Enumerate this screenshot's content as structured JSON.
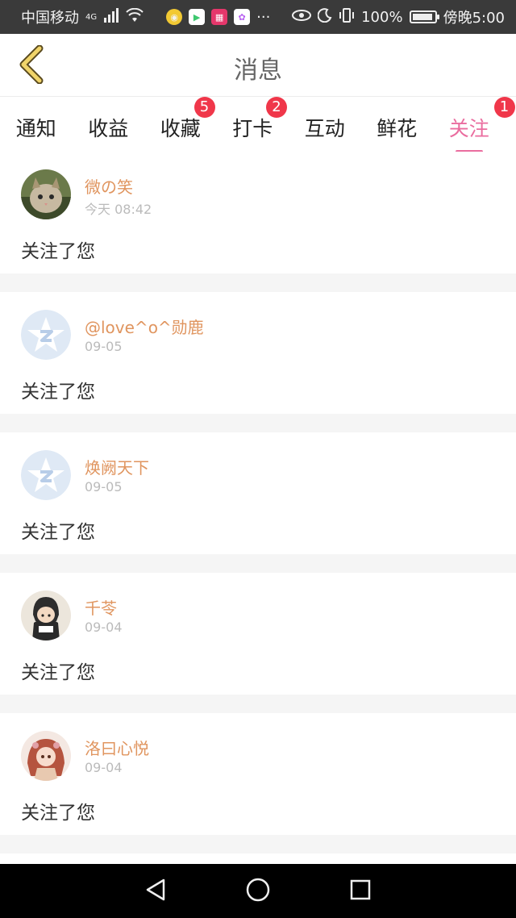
{
  "status_bar": {
    "carrier": "中国移动",
    "network": "4G",
    "battery": "100%",
    "time": "傍晚5:00"
  },
  "header": {
    "title": "消息"
  },
  "tabs": [
    {
      "label": "通知",
      "badge": ""
    },
    {
      "label": "收益",
      "badge": ""
    },
    {
      "label": "收藏",
      "badge": "5"
    },
    {
      "label": "打卡",
      "badge": "2"
    },
    {
      "label": "互动",
      "badge": ""
    },
    {
      "label": "鲜花",
      "badge": ""
    },
    {
      "label": "关注",
      "badge": "1",
      "active": true
    }
  ],
  "messages": [
    {
      "name": "微の笑",
      "time": "今天 08:42",
      "text": "关注了您",
      "avatar": "kitten-photo"
    },
    {
      "name": "@love^o^勋鹿",
      "time": "09-05",
      "text": "关注了您",
      "avatar": "qq-default"
    },
    {
      "name": "焕阙天下",
      "time": "09-05",
      "text": "关注了您",
      "avatar": "qq-default"
    },
    {
      "name": "千苓",
      "time": "09-04",
      "text": "关注了您",
      "avatar": "hooded-figure"
    },
    {
      "name": "洛曰心悦",
      "time": "09-04",
      "text": "关注了您",
      "avatar": "anime-girl"
    }
  ],
  "colors": {
    "accent": "#ea6d9f",
    "name": "#e0955f",
    "badge": "#f0374a"
  }
}
